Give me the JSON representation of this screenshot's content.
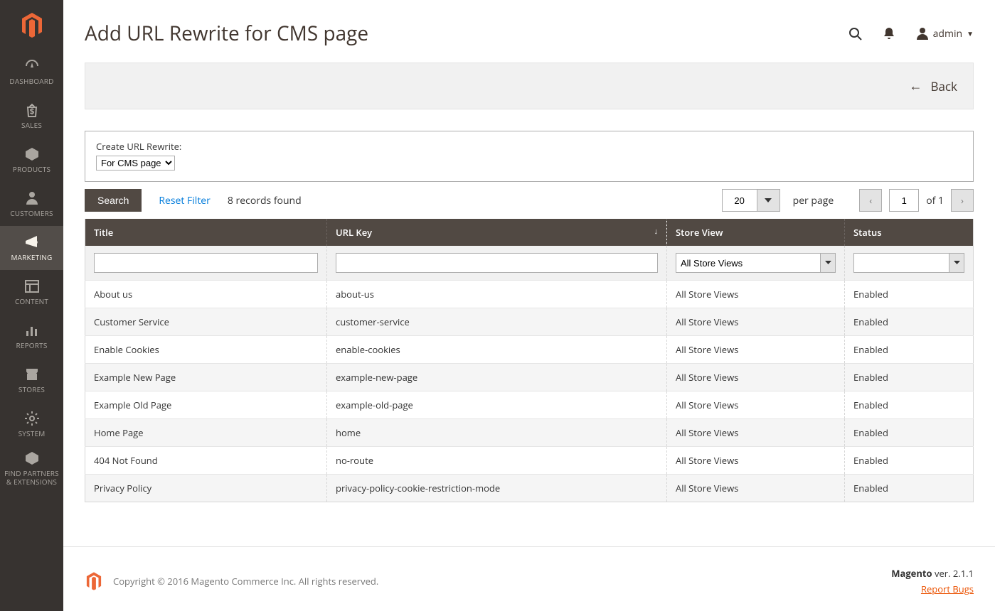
{
  "page_title": "Add URL Rewrite for CMS page",
  "user": {
    "name": "admin"
  },
  "sidebar": {
    "items": [
      {
        "label": "DASHBOARD",
        "icon": "dashboard"
      },
      {
        "label": "SALES",
        "icon": "sales"
      },
      {
        "label": "PRODUCTS",
        "icon": "products"
      },
      {
        "label": "CUSTOMERS",
        "icon": "customers"
      },
      {
        "label": "MARKETING",
        "icon": "marketing",
        "active": true
      },
      {
        "label": "CONTENT",
        "icon": "content"
      },
      {
        "label": "REPORTS",
        "icon": "reports"
      },
      {
        "label": "STORES",
        "icon": "stores"
      },
      {
        "label": "SYSTEM",
        "icon": "system"
      },
      {
        "label": "FIND PARTNERS\n& EXTENSIONS",
        "icon": "partners"
      }
    ]
  },
  "actions": {
    "back_label": "Back"
  },
  "selector": {
    "label": "Create URL Rewrite:",
    "value": "For CMS page"
  },
  "toolbar": {
    "search_label": "Search",
    "reset_label": "Reset Filter",
    "records_text": "8 records found",
    "page_size": "20",
    "per_page_label": "per page",
    "current_page": "1",
    "of_label": "of 1"
  },
  "filters": {
    "store_view_value": "All Store Views"
  },
  "columns": {
    "title": "Title",
    "url_key": "URL Key",
    "store_view": "Store View",
    "status": "Status"
  },
  "rows": [
    {
      "title": "About us",
      "url_key": "about-us",
      "store": "All Store Views",
      "status": "Enabled"
    },
    {
      "title": "Customer Service",
      "url_key": "customer-service",
      "store": "All Store Views",
      "status": "Enabled"
    },
    {
      "title": "Enable Cookies",
      "url_key": "enable-cookies",
      "store": "All Store Views",
      "status": "Enabled"
    },
    {
      "title": "Example New Page",
      "url_key": "example-new-page",
      "store": "All Store Views",
      "status": "Enabled"
    },
    {
      "title": "Example Old Page",
      "url_key": "example-old-page",
      "store": "All Store Views",
      "status": "Enabled"
    },
    {
      "title": "Home Page",
      "url_key": "home",
      "store": "All Store Views",
      "status": "Enabled"
    },
    {
      "title": "404 Not Found",
      "url_key": "no-route",
      "store": "All Store Views",
      "status": "Enabled"
    },
    {
      "title": "Privacy Policy",
      "url_key": "privacy-policy-cookie-restriction-mode",
      "store": "All Store Views",
      "status": "Enabled"
    }
  ],
  "footer": {
    "copyright": "Copyright © 2016 Magento Commerce Inc. All rights reserved.",
    "brand": "Magento",
    "version": " ver. 2.1.1",
    "bugs_label": "Report Bugs"
  }
}
